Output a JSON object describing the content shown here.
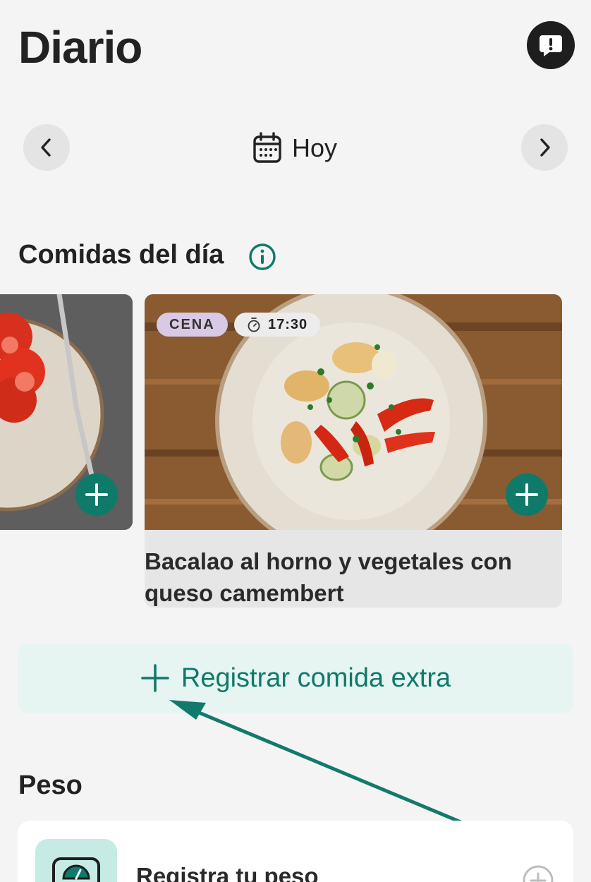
{
  "header": {
    "title": "Diario",
    "feedback_icon": "exclamation-bubble-icon"
  },
  "date_nav": {
    "label": "Hoy",
    "prev_icon": "chevron-left-icon",
    "next_icon": "chevron-right-icon",
    "calendar_icon": "calendar-icon"
  },
  "meals": {
    "section_title": "Comidas del día",
    "info_icon": "info-icon",
    "cards": [
      {
        "image": "tomato-salad-plate-photo"
      },
      {
        "meal_type": "CENA",
        "time": "17:30",
        "title": "Bacalao al horno y vegetales con queso camembert",
        "image": "baked-cod-vegetables-photo"
      }
    ],
    "extra_button_label": "Registrar comida extra"
  },
  "weight": {
    "section_title": "Peso",
    "register_label": "Registra tu peso",
    "icon": "scale-icon"
  },
  "colors": {
    "accent": "#0f7a6a",
    "accent_light": "#e6f4f2",
    "dinner_badge": "#d8c9e4",
    "background": "#f4f4f4"
  }
}
